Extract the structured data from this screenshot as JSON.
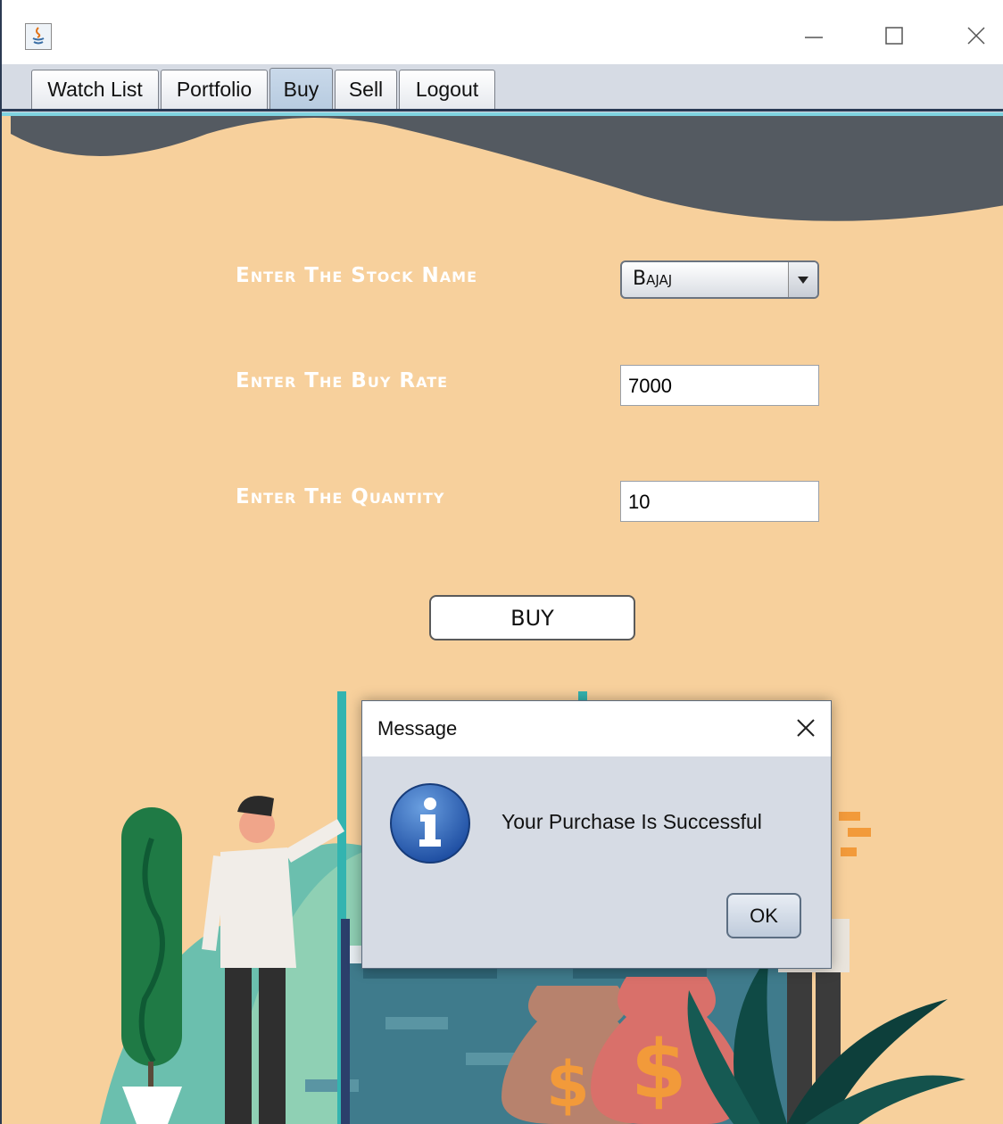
{
  "window": {
    "tabs": [
      {
        "label": "Watch List"
      },
      {
        "label": "Portfolio"
      },
      {
        "label": "Buy"
      },
      {
        "label": "Sell"
      },
      {
        "label": "Logout"
      }
    ],
    "selected_tab": "Buy"
  },
  "form": {
    "stock_label": "Enter The Stock Name",
    "stock_value": "Bajaj",
    "rate_label": "Enter The Buy Rate",
    "rate_value": "7000",
    "qty_label": "Enter The Quantity",
    "qty_value": "10",
    "buy_button": "BUY"
  },
  "dialog": {
    "title": "Message",
    "message": "Your Purchase Is Successful",
    "ok_button": "OK",
    "icon": "info-icon"
  },
  "colors": {
    "background": "#f7d09c",
    "wave": "#545a61",
    "tab_selected": "#b7cbe0",
    "dialog_bg": "#d6dbe4"
  }
}
